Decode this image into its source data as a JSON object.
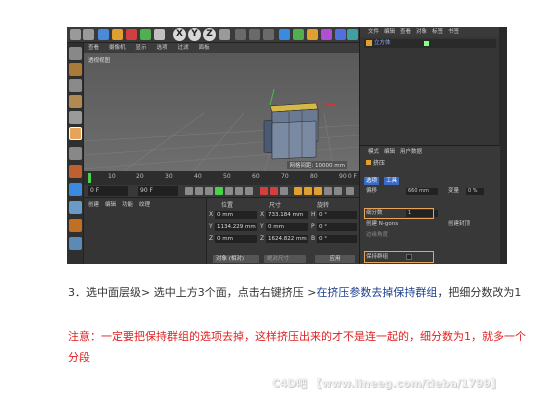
{
  "toolbar": {
    "axis_buttons": [
      "X",
      "Y",
      "Z"
    ]
  },
  "viewport": {
    "menu": [
      "查看",
      "摄像机",
      "显示",
      "选项",
      "过滤",
      "面板"
    ],
    "label": "透视视图",
    "grid_info": "网格间距: 10000 mm"
  },
  "timeline": {
    "ticks": [
      "10",
      "20",
      "30",
      "40",
      "50",
      "60",
      "70",
      "80",
      "90"
    ],
    "current_frame": "0 F",
    "start_field": "0 F",
    "end_field": "90 F"
  },
  "material_panel": {
    "menu": [
      "创建",
      "编辑",
      "功能",
      "纹理"
    ]
  },
  "coord_panel": {
    "headers": [
      "位置",
      "尺寸",
      "旋转"
    ],
    "rows": [
      {
        "axis": "X",
        "pos": "0 mm",
        "size_axis": "X",
        "size": "733.184 mm",
        "rot_axis": "H",
        "rot": "0 °"
      },
      {
        "axis": "Y",
        "pos": "1134.229 mm",
        "size_axis": "Y",
        "size": "0 mm",
        "rot_axis": "P",
        "rot": "0 °"
      },
      {
        "axis": "Z",
        "pos": "0 mm",
        "size_axis": "Z",
        "size": "1624.822 mm",
        "rot_axis": "B",
        "rot": "0 °"
      }
    ],
    "mode_select": "对象 (相对)",
    "size_select": "绝对尺寸",
    "apply_button": "应用"
  },
  "object_manager": {
    "menu": [
      "文件",
      "编辑",
      "查看",
      "对象",
      "标签",
      "书签"
    ],
    "object_name": "立方体"
  },
  "attributes": {
    "menu": [
      "模式",
      "编辑",
      "用户数据"
    ],
    "title": "挤压",
    "tabs": [
      "选项",
      "工具"
    ],
    "fields": {
      "offset_label": "偏移",
      "offset_value": "660 mm",
      "variance_label": "变量",
      "variance_value": "0 %",
      "subdivision_label": "细分数",
      "subdivision_value": "1",
      "ngons_label": "创建 N-gons",
      "edge_angle_label": "边缘角度",
      "cap_label": "创建封顶",
      "keep_groups_label": "保持群组",
      "max_angle_label": "最大角度"
    }
  },
  "instructions": {
    "step_part1": "3．选中面层级> 选中上方3个面，点击右键挤压 >",
    "step_highlight": "在挤压参数去掉保持群组",
    "step_part2": "，把细分数改为1",
    "note": "注意：一定要把保持群组的选项去掉，这样挤压出来的才不是连一起的，细分数为1，就多一个分段"
  },
  "watermark": "C4D吧 【www.lineeg.com/tieba/1799】",
  "colors": {
    "highlight": "#e8a35b",
    "note_red": "#e02020",
    "step_blue": "#1e3f8f"
  }
}
